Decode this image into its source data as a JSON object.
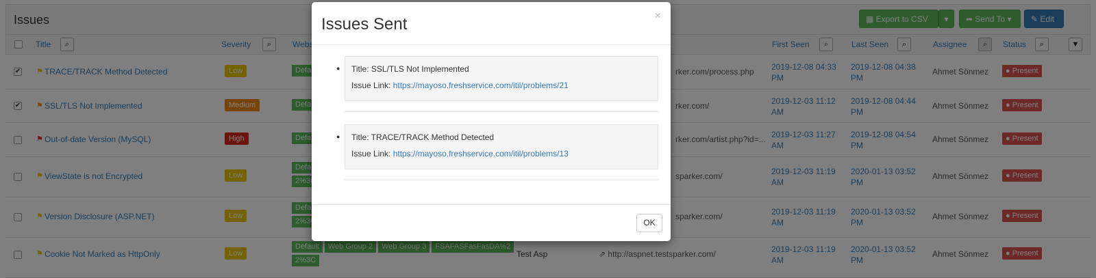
{
  "page": {
    "title": "Issues",
    "toolbar": {
      "export_label": "Export to CSV",
      "send_label": "Send To",
      "edit_label": "Edit"
    }
  },
  "columns": {
    "title": "Title",
    "severity": "Severity",
    "website": "Webs",
    "first_seen": "First Seen",
    "last_seen": "Last Seen",
    "assignee": "Assignee",
    "status": "Status"
  },
  "rows": [
    {
      "checked": true,
      "flag": "yellow",
      "title": "TRACE/TRACK Method Detected",
      "severity": "Low",
      "tags": [
        "Defa"
      ],
      "tags_line2": [],
      "url": "rker.com/process.php",
      "first_seen": "2019-12-08 04:33 PM",
      "last_seen": "2019-12-08 04:38 PM",
      "assignee": "Ahmet Sönmez",
      "status": "Present"
    },
    {
      "checked": true,
      "flag": "orange",
      "title": "SSL/TLS Not Implemented",
      "severity": "Medium",
      "tags": [
        "Defa"
      ],
      "tags_line2": [],
      "url": "rker.com/",
      "first_seen": "2019-12-03 11:12 AM",
      "last_seen": "2019-12-08 04:44 PM",
      "assignee": "Ahmet Sönmez",
      "status": "Present"
    },
    {
      "checked": false,
      "flag": "red",
      "title": "Out-of-date Version (MySQL)",
      "severity": "High",
      "tags": [
        "Defa"
      ],
      "tags_line2": [],
      "url": "rker.com/artist.php?id=...",
      "first_seen": "2019-12-03 11:27 AM",
      "last_seen": "2019-12-08 04:54 PM",
      "assignee": "Ahmet Sönmez",
      "status": "Present"
    },
    {
      "checked": false,
      "flag": "yellow",
      "title": "ViewState is not Encrypted",
      "severity": "Low",
      "tags": [
        "Defa"
      ],
      "tags_line2": [
        "2%3C"
      ],
      "url": "sparker.com/",
      "first_seen": "2019-12-03 11:19 AM",
      "last_seen": "2020-01-13 03:52 PM",
      "assignee": "Ahmet Sönmez",
      "status": "Present"
    },
    {
      "checked": false,
      "flag": "yellow",
      "title": "Version Disclosure (ASP.NET)",
      "severity": "Low",
      "tags": [
        "Defa"
      ],
      "tags_line2": [
        "2%3C"
      ],
      "url": "sparker.com/",
      "first_seen": "2019-12-03 11:19 AM",
      "last_seen": "2020-01-13 03:52 PM",
      "assignee": "Ahmet Sönmez",
      "status": "Present"
    },
    {
      "checked": false,
      "flag": "yellow",
      "title": "Cookie Not Marked as HttpOnly",
      "severity": "Low",
      "tags": [
        "Default",
        "Web Group 2",
        "Web Group 3",
        "FSAFASFasFasDA%2"
      ],
      "tags_line2": [
        "2%3C"
      ],
      "website_name": "Test Asp",
      "url": "http://aspnet.testsparker.com/",
      "first_seen": "2019-12-03 11:19 AM",
      "last_seen": "2020-01-13 03:52 PM",
      "assignee": "Ahmet Sönmez",
      "status": "Present"
    }
  ],
  "modal": {
    "title": "Issues Sent",
    "close": "×",
    "items": [
      {
        "title_label": "Title: SSL/TLS Not Implemented",
        "link_label": "Issue Link: ",
        "link": "https://mayoso.freshservice.com/itil/problems/21"
      },
      {
        "title_label": "Title: TRACE/TRACK Method Detected",
        "link_label": "Issue Link: ",
        "link": "https://mayoso.freshservice.com/itil/problems/13"
      }
    ],
    "ok_label": "OK"
  },
  "colors": {
    "link": "#337ab7",
    "green_button": "#5cb85c",
    "blue_button": "#337ab7",
    "severity_low": "#e8c200",
    "severity_medium": "#f0860e",
    "severity_high": "#d9261c",
    "status_present": "#d9534f"
  }
}
